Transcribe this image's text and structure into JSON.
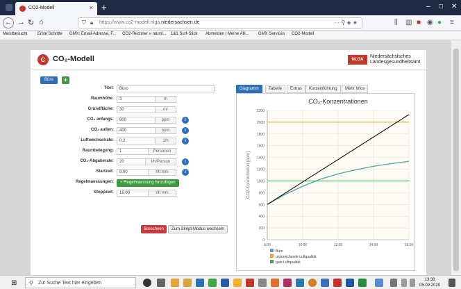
{
  "browser": {
    "tab_title": "CO2-Modell",
    "url_prefix": "https://www.co2-modell.nlga.",
    "url_domain": "niedersachsen.de",
    "url_more": "···",
    "bookmarks": [
      "Meistbesucht",
      "Erste Schritte",
      "GMX: Email-Adresse, F...",
      "CO2-Rechner » rauml...",
      "1&1 Surf-Stick",
      "Abmelden | Meine Alli...",
      "GMX Services",
      "CO2-Modell"
    ]
  },
  "app": {
    "title": "CO₂-Modell",
    "logo_letter": "C",
    "org_badge": "NLGA",
    "org_line1": "Niedersächsisches",
    "org_line2": "Landesgesundheitsamt",
    "room_tab": "Büro",
    "add_tab": "+"
  },
  "form": {
    "titel": {
      "label": "Titel:",
      "value": "Büro"
    },
    "raumhoehe": {
      "label": "Raumhöhe:",
      "value": "3",
      "unit": "m"
    },
    "grundflaeche": {
      "label": "Grundfläche:",
      "value": "30",
      "unit": "m²"
    },
    "co2_anfang": {
      "label": "CO₂ anfangs:",
      "value": "600",
      "unit": "ppm"
    },
    "co2_aussen": {
      "label": "CO₂ außen:",
      "value": "400",
      "unit": "ppm"
    },
    "luftwechselrate": {
      "label": "Luftwechselrate:",
      "value": "0.2",
      "unit": "1/h"
    },
    "raumbelegung": {
      "label": "Raumbelegung:",
      "value": "1",
      "unit": "Personen"
    },
    "co2_abgaberate": {
      "label": "CO₂-Abgaberate:",
      "value": "20",
      "unit": "l/h/Person"
    },
    "startzeit": {
      "label": "Startzeit:",
      "value": "8:00",
      "unit": "hh:mm"
    },
    "regelmaessungen": {
      "label": "Regelmaessungen:",
      "button": "+ Regelmaessung hinzufügen"
    },
    "stoppzeit": {
      "label": "Stoppzeit:",
      "value": "16:00",
      "unit": "hh:mm"
    },
    "info_glyph": "i",
    "calc_button": "Berechnen",
    "script_button": "Zum Skript-Modus wechseln"
  },
  "chart_tabs": [
    "Diagramm",
    "Tabelle",
    "Extras",
    "Kurzeinführung",
    "Mehr Infos"
  ],
  "chart_data": {
    "type": "line",
    "title": "CO₂-Konzentrationen",
    "ylabel": "CO2-Konzentration [ppm]",
    "xlabel": "",
    "xlim": [
      8,
      16
    ],
    "ylim": [
      0,
      2200
    ],
    "xticks": [
      "8:00",
      "10:00",
      "12:00",
      "14:00",
      "16:00"
    ],
    "yticks": [
      0,
      200,
      400,
      600,
      800,
      1000,
      1200,
      1400,
      1600,
      1800,
      2000,
      2200
    ],
    "grid": true,
    "legend": "bottom",
    "series": [
      {
        "name": "Büro",
        "color": "#5aa6b0",
        "x": [
          8,
          9,
          10,
          11,
          12,
          13,
          14,
          15,
          16
        ],
        "y": [
          600,
          770,
          910,
          1030,
          1120,
          1190,
          1250,
          1295,
          1335
        ]
      },
      {
        "name": "unzureichende Luftqualität",
        "color": "#f0a020",
        "x": [
          8,
          16
        ],
        "y": [
          2000,
          2000
        ]
      },
      {
        "name": "gute Luftqualität",
        "color": "#3fa84a",
        "x": [
          8,
          16
        ],
        "y": [
          1000,
          1000
        ]
      },
      {
        "name": "",
        "color": "#000000",
        "x": [
          8,
          16
        ],
        "y": [
          600,
          2130
        ]
      }
    ]
  },
  "taskbar": {
    "search_placeholder": "Zur Suche Text hier eingeben",
    "time": "13:38",
    "date": "05.09.2020"
  }
}
